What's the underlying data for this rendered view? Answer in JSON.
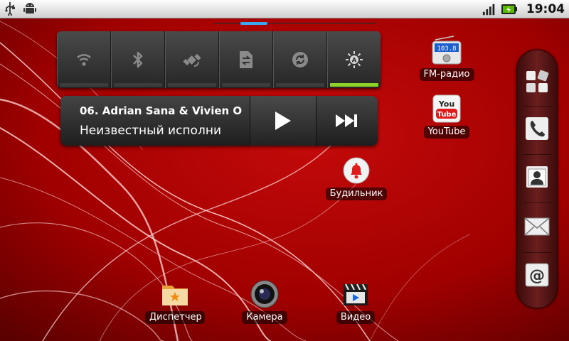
{
  "statusbar": {
    "time": "19:04",
    "left_icons": [
      "usb-icon",
      "android-debug-icon"
    ],
    "right_icons": [
      "signal-icon",
      "battery-charging-icon"
    ]
  },
  "pager": {
    "current_page": 3,
    "total_pages": 5
  },
  "power_widget": {
    "toggles": [
      {
        "name": "wifi",
        "icon": "wifi-icon",
        "on": false
      },
      {
        "name": "bluetooth",
        "icon": "bluetooth-icon",
        "on": false
      },
      {
        "name": "gps",
        "icon": "gps-icon",
        "on": false
      },
      {
        "name": "sync",
        "icon": "sync-icon",
        "on": false
      },
      {
        "name": "auto-rotate",
        "icon": "rotate-icon",
        "on": false
      },
      {
        "name": "brightness",
        "icon": "brightness-icon",
        "on": true
      }
    ]
  },
  "music_widget": {
    "track": "06. Adrian Sana & Vivien O",
    "artist": "Неизвестный исполни"
  },
  "apps": {
    "fm_radio": {
      "label": "FM-радио",
      "freq": "103.8"
    },
    "youtube": {
      "label": "YouTube",
      "logo_top": "You",
      "logo_bottom": "Tube"
    },
    "alarm": {
      "label": "Будильник"
    },
    "files": {
      "label": "Диспетчер"
    },
    "camera": {
      "label": "Камера"
    },
    "video": {
      "label": "Видео"
    }
  },
  "dock": {
    "items": [
      "all-apps",
      "phone",
      "contacts",
      "messaging",
      "email"
    ]
  },
  "colors": {
    "accent_green": "#8fd12a",
    "wallpaper_red": "#b00000"
  }
}
